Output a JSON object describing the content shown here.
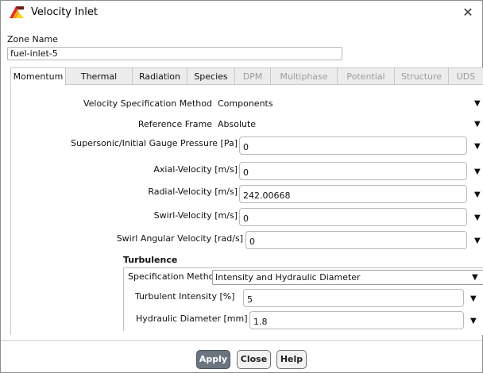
{
  "window": {
    "title": "Velocity Inlet",
    "close_glyph": "✕"
  },
  "zone": {
    "label": "Zone Name",
    "value": "fuel-inlet-5"
  },
  "tabs": [
    {
      "label": "Momentum",
      "state": "active"
    },
    {
      "label": "Thermal",
      "state": "enabled"
    },
    {
      "label": "Radiation",
      "state": "enabled"
    },
    {
      "label": "Species",
      "state": "enabled"
    },
    {
      "label": "DPM",
      "state": "disabled"
    },
    {
      "label": "Multiphase",
      "state": "disabled"
    },
    {
      "label": "Potential",
      "state": "disabled"
    },
    {
      "label": "Structure",
      "state": "disabled"
    },
    {
      "label": "UDS",
      "state": "disabled"
    }
  ],
  "momentum": {
    "velocity_method": {
      "label": "Velocity Specification Method",
      "value": "Components"
    },
    "reference_frame": {
      "label": "Reference Frame",
      "value": "Absolute"
    },
    "supersonic_pressure": {
      "label": "Supersonic/Initial Gauge Pressure [Pa]",
      "value": "0"
    },
    "axial_velocity": {
      "label": "Axial-Velocity [m/s]",
      "value": "0"
    },
    "radial_velocity": {
      "label": "Radial-Velocity [m/s]",
      "value": "242.00668"
    },
    "swirl_velocity": {
      "label": "Swirl-Velocity [m/s]",
      "value": "0"
    },
    "swirl_angular_velocity": {
      "label": "Swirl Angular Velocity [rad/s]",
      "value": "0"
    }
  },
  "turbulence": {
    "title": "Turbulence",
    "spec_method": {
      "label": "Specification Method",
      "value": "Intensity and Hydraulic Diameter"
    },
    "intensity": {
      "label": "Turbulent Intensity [%]",
      "value": "5"
    },
    "hydraulic_diameter": {
      "label": "Hydraulic Diameter [mm]",
      "value": "1.8"
    }
  },
  "buttons": {
    "apply": "Apply",
    "close": "Close",
    "help": "Help"
  },
  "icons": {
    "app": "fluent-app-icon",
    "dropdown": "▼"
  },
  "colors": {
    "apply_bg": "#6b7580",
    "tab_inactive_bg": "#ececec"
  }
}
